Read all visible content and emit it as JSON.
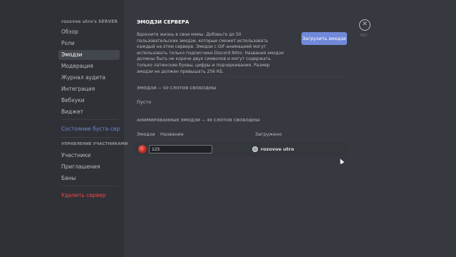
{
  "sidebar": {
    "server_title": "rozovoe utro's SERVER",
    "items": [
      {
        "label": "Обзор"
      },
      {
        "label": "Роли"
      },
      {
        "label": "Эмодзи"
      },
      {
        "label": "Модерация"
      },
      {
        "label": "Журнал аудита"
      },
      {
        "label": "Интеграция"
      },
      {
        "label": "Вебхуки"
      },
      {
        "label": "Виджет"
      }
    ],
    "boost_status": "Состояние буста серв...",
    "user_management_label": "УПРАВЛЕНИЕ УЧАСТНИКАМИ",
    "user_items": [
      {
        "label": "Участники"
      },
      {
        "label": "Приглашения"
      },
      {
        "label": "Баны"
      }
    ],
    "delete_server": "Удалить сервер"
  },
  "main": {
    "title": "ЭМОДЗИ СЕРВЕРА",
    "description": "Вдохните жизнь в свои мемы. Добавьте до 50 пользовательских эмодзи, которые сможет использовать каждый на этом сервере. Эмодзи с GIF-анимацией могут использовать только подписчики Discord Nitro. Названия эмодзи должны быть не короче двух символов и могут содержать только латинские буквы, цифры и подчеркивания. Размер эмодзи не должен превышать 256 КБ.",
    "upload_button": "Загрузить эмодзи",
    "close_hint": "ESC",
    "static_header": "ЭМОДЗИ — 50 СЛОТОВ СВОБОДНЫ",
    "static_empty": "Пусто",
    "animated_header": "АНИМИРОВАННЫЕ ЭМОДЗИ — 49 СЛОТОВ СВОБОДНЫ",
    "columns": {
      "emoji": "Эмодзи",
      "name": "Название",
      "uploaded_by": "Загружено"
    },
    "emoji_rows": [
      {
        "name": "123",
        "uploader": "rozovoe utro"
      }
    ]
  },
  "colors": {
    "accent": "#7289da",
    "danger": "#f04747",
    "background": "#36393f",
    "sidebar": "#2f3136"
  },
  "icons": {
    "close": "close-icon",
    "emoji": "red-gem-emoji"
  }
}
